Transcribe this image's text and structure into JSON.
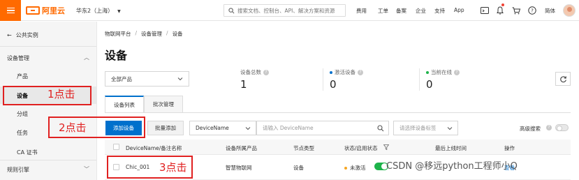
{
  "topbar": {
    "logo_text": "阿里云",
    "region": "华东2（上海）",
    "search_placeholder": "搜索文档、控制台、API、解决方案和资源",
    "nav": [
      "费用",
      "工单",
      "备案",
      "企业",
      "支持",
      "App"
    ],
    "language": "简体",
    "icons": [
      "menu-icon",
      "search-icon",
      "terminal-icon",
      "bell-icon",
      "cart-icon",
      "help-icon"
    ],
    "brand_color": "#ff6a00"
  },
  "sidebar": {
    "back_label": "公共实例",
    "group_device": "设备管理",
    "items": [
      "产品",
      "设备",
      "分组",
      "任务",
      "CA 证书"
    ],
    "group_rules": "规则引擎",
    "active_item": "设备"
  },
  "annotations": {
    "click1": "1点击",
    "click2": "2点击",
    "click3": "3点击",
    "color": "#e02020"
  },
  "main": {
    "breadcrumb": [
      "物联网平台",
      "设备管理",
      "设备"
    ],
    "breadcrumb_sep": "/",
    "title": "设备",
    "product_select": "全部产品",
    "stats": [
      {
        "label": "设备总数",
        "value": "1",
        "dot": null
      },
      {
        "label": "激活设备",
        "value": "0",
        "dot": "#0070cc"
      },
      {
        "label": "当前在线",
        "value": "0",
        "dot": "#1db34a"
      }
    ],
    "tabs": [
      "设备列表",
      "批次管理"
    ],
    "active_tab": "设备列表",
    "toolbar": {
      "add_device": "添加设备",
      "batch_add": "批量添加",
      "filter_field": "DeviceName",
      "filter_placeholder": "请输入 DeviceName",
      "tag_placeholder": "请选择设备标签",
      "advanced_search": "高级搜索"
    },
    "table": {
      "columns": [
        "DeviceName/备注名称",
        "设备所属产品",
        "节点类型",
        "状态/启用状态",
        "最后上线时间",
        "操作"
      ],
      "rows": [
        {
          "name": "Chic_001",
          "product": "智慧物联网",
          "node_type": "设备",
          "status": "未激活",
          "last_online": "",
          "ops": "查看"
        }
      ]
    },
    "primary_color": "#0070cc"
  },
  "watermark": "CSDN @移远python工程师小Q"
}
